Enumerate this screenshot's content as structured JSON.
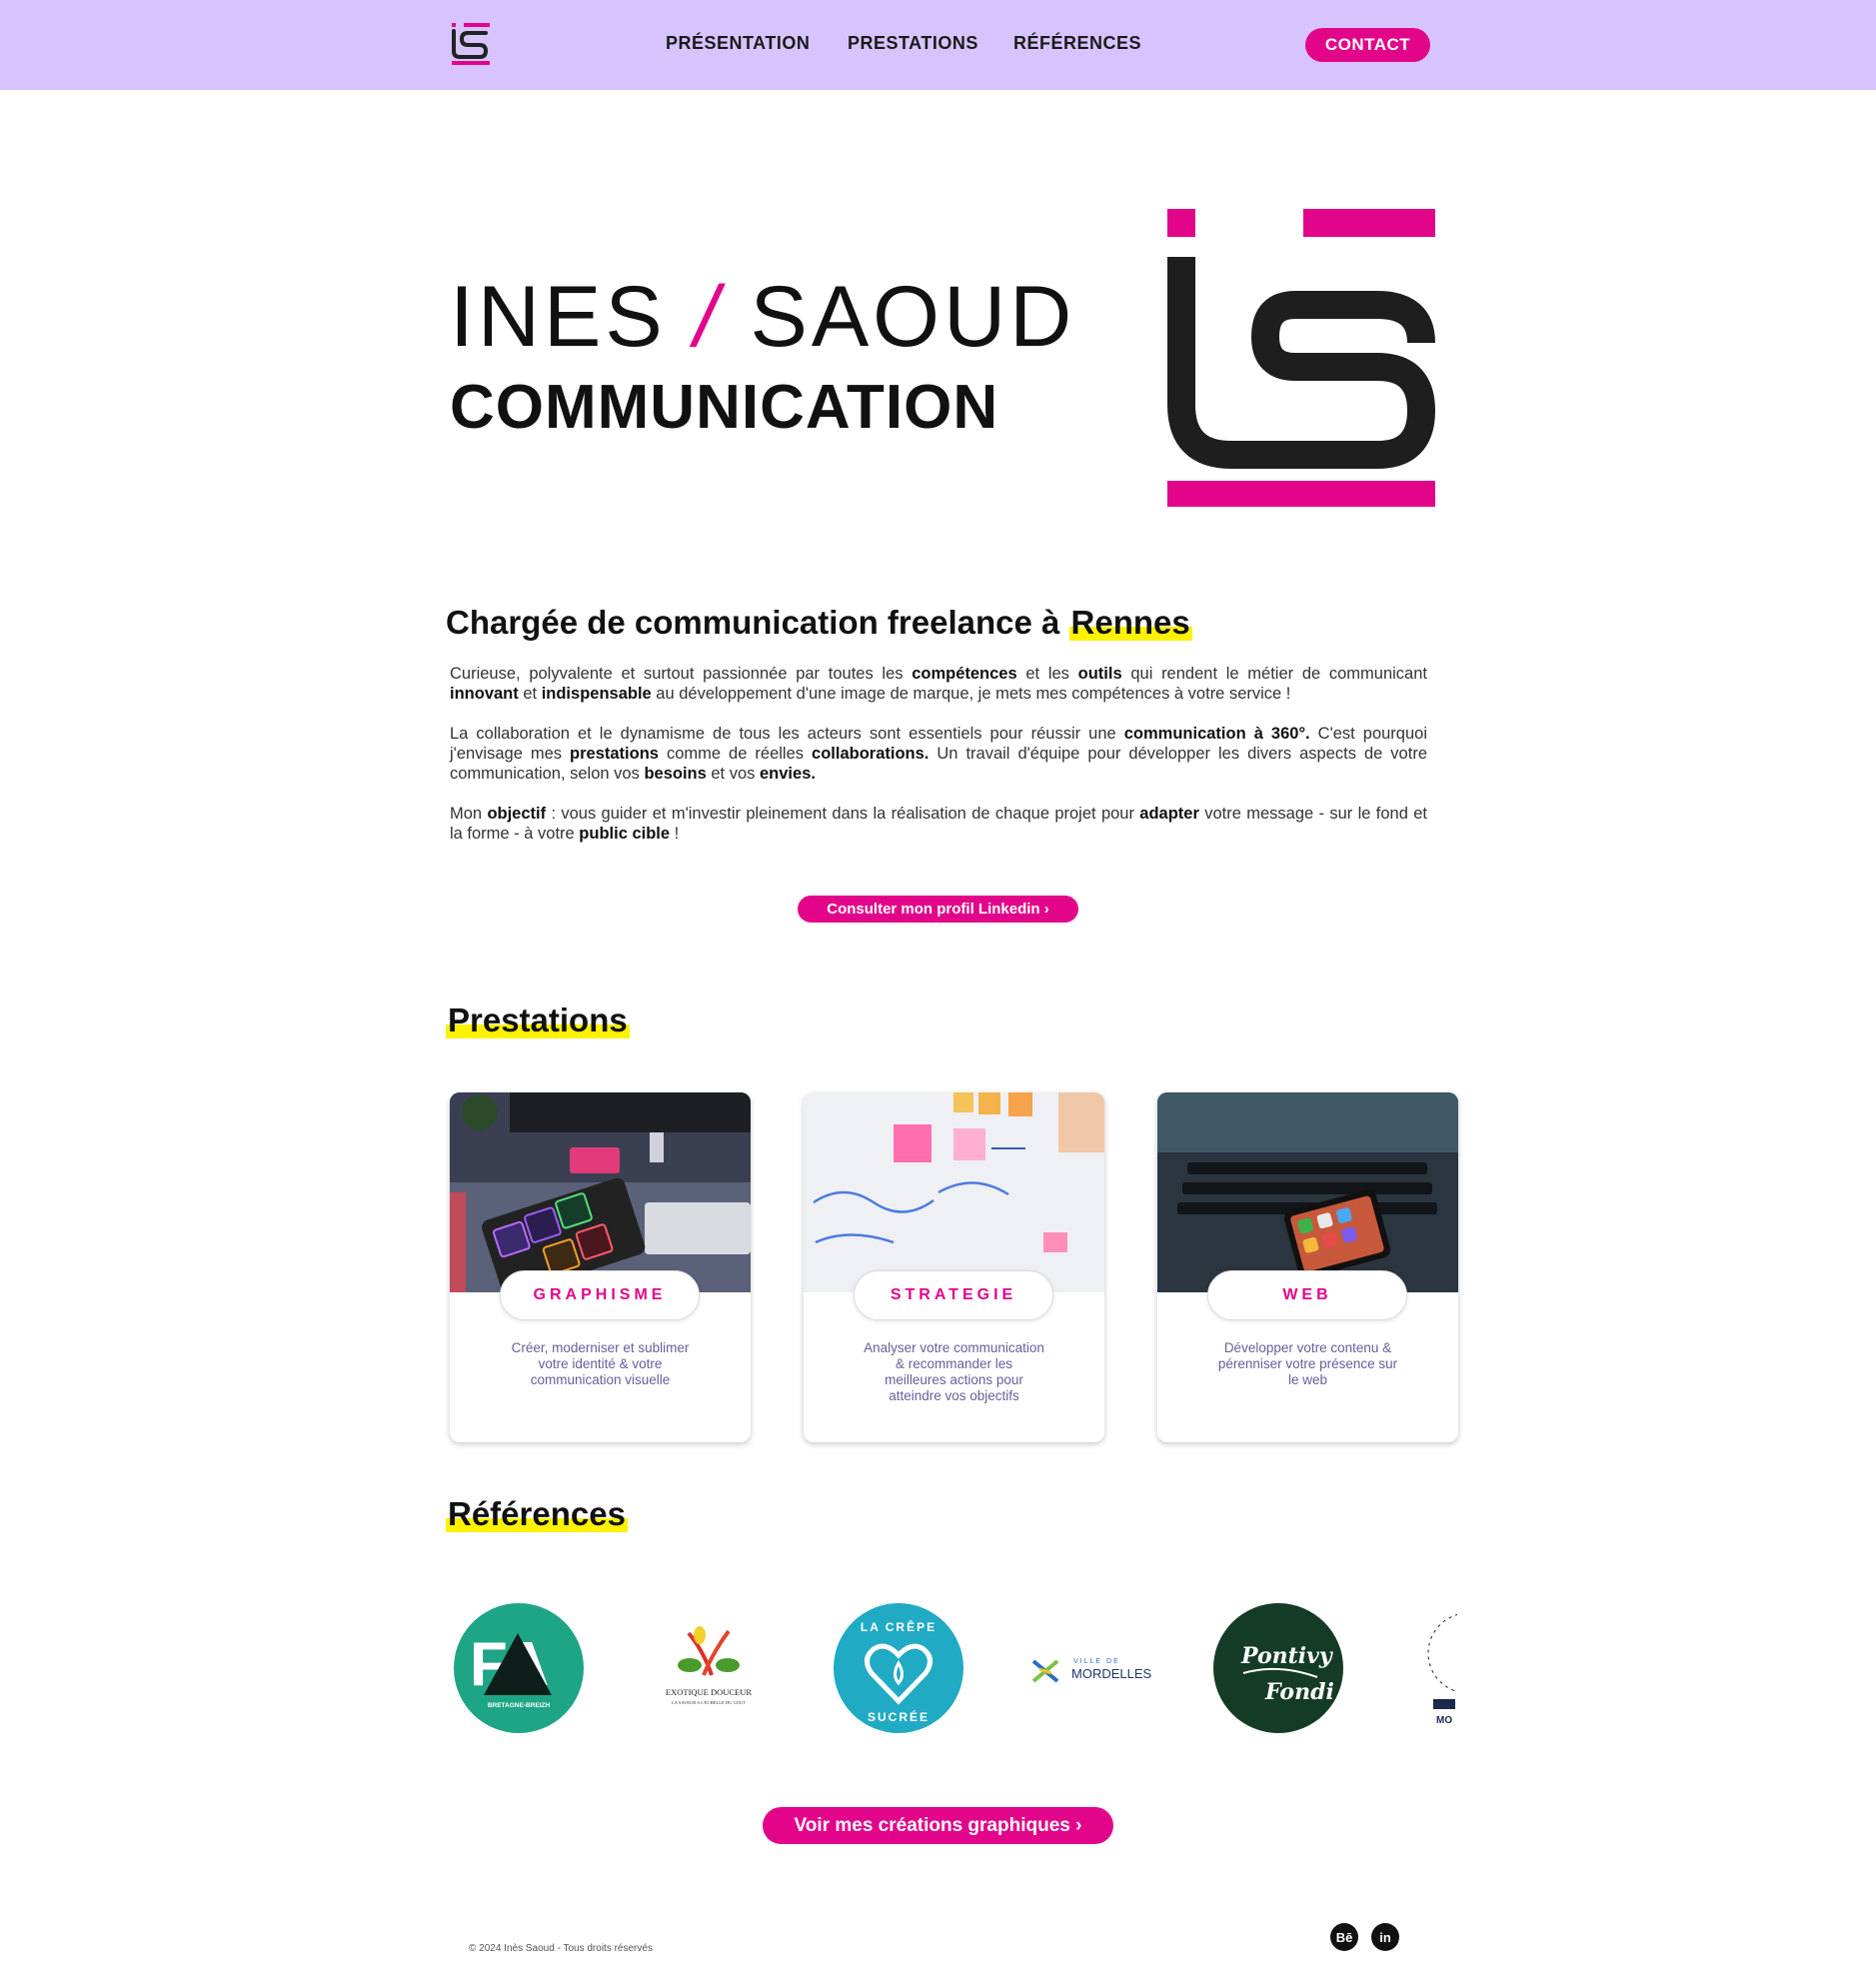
{
  "header": {
    "logo_alt": "IS",
    "nav": [
      "PRÉSENTATION",
      "PRESTATIONS",
      "RÉFÉRENCES"
    ],
    "contact": "CONTACT"
  },
  "hero": {
    "first": "INES",
    "slash": "/",
    "last": "SAOUD",
    "subtitle": "COMMUNICATION"
  },
  "intro": {
    "heading_prefix": "Chargée de communication freelance à ",
    "heading_city": "Rennes",
    "p1": [
      {
        "t": "Curieuse, polyvalente et surtout passionnée par toutes les "
      },
      {
        "b": "compétences"
      },
      {
        "t": " et les "
      },
      {
        "b": "outils"
      },
      {
        "t": " qui rendent le métier de communicant "
      },
      {
        "b": "innovant"
      },
      {
        "t": " et "
      },
      {
        "b": "indispensable"
      },
      {
        "t": " au développement d'une image de marque, je mets mes compétences à votre service !"
      }
    ],
    "p2": [
      {
        "t": "La collaboration et le dynamisme de tous les acteurs sont essentiels pour réussir une "
      },
      {
        "b": "communication à 360°."
      },
      {
        "t": " C'est pourquoi j'envisage mes "
      },
      {
        "b": "prestations"
      },
      {
        "t": " comme de réelles "
      },
      {
        "b": "collaborations."
      },
      {
        "t": " Un travail d'équipe pour développer les divers aspects de votre communication, selon vos "
      },
      {
        "b": "besoins"
      },
      {
        "t": " et vos "
      },
      {
        "b": "envies."
      }
    ],
    "p3": [
      {
        "t": "Mon "
      },
      {
        "b": "objectif"
      },
      {
        "t": " : vous guider et m'investir pleinement dans la réalisation de chaque projet pour "
      },
      {
        "b": "adapter"
      },
      {
        "t": " votre message - sur le fond et la forme - à votre "
      },
      {
        "b": "public cible"
      },
      {
        "t": " !"
      }
    ],
    "linkedin_button": "Consulter mon profil Linkedin ›"
  },
  "prestations": {
    "heading": "Prestations",
    "cards": [
      {
        "label": "GRAPHISME",
        "desc": "Créer, moderniser et sublimer votre identité & votre communication visuelle"
      },
      {
        "label": "STRATEGIE",
        "desc": "Analyser votre communication & recommander les meilleures actions pour atteindre vos objectifs"
      },
      {
        "label": "WEB",
        "desc": "Développer votre contenu & pérenniser votre présence sur le web"
      }
    ]
  },
  "references": {
    "heading": "Références",
    "logos": [
      {
        "name": "fa-bretagne-breizh",
        "text": "FA",
        "sub": "BRETAGNE-BREIZH"
      },
      {
        "name": "exotique-douceur",
        "text": "EXOTIQUE DOUCEUR",
        "sub": "LA SAVEUR A L'ECHELLE DU GOUT"
      },
      {
        "name": "la-crepe-sucree",
        "top": "LA CRÊPE",
        "bottom": "SUCRÉE"
      },
      {
        "name": "ville-de-mordelles",
        "top": "VILLE DE",
        "text": "MORDELLES"
      },
      {
        "name": "pontivy-fondi",
        "text": "Pontivy",
        "sub": "Fondi"
      },
      {
        "name": "partial-logo",
        "text": "MO"
      }
    ],
    "button": "Voir mes créations graphiques ›"
  },
  "footer": {
    "copyright": "© 2024 Inès Saoud - Tous droits réservés",
    "behance": "Bē",
    "linkedin": "in"
  },
  "colors": {
    "header_bg": "#d7c4ff",
    "accent": "#e2058a",
    "highlight": "#fff200",
    "card_text": "#6a5d9a"
  }
}
